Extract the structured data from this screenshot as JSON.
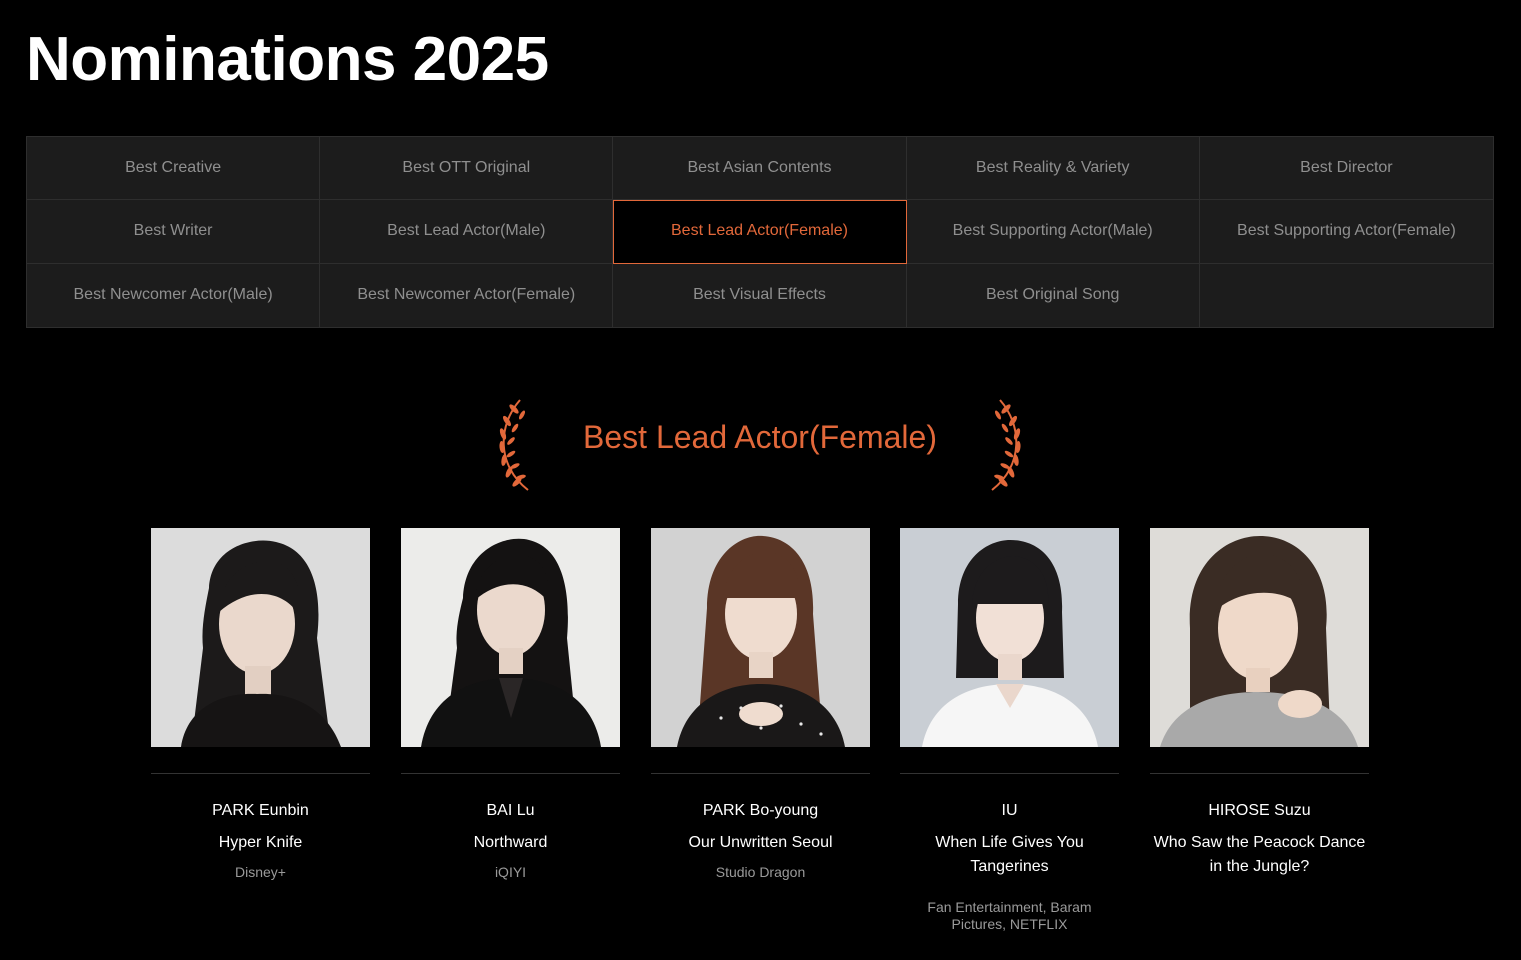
{
  "page": {
    "title": "Nominations 2025"
  },
  "categories": [
    {
      "label": "Best Creative",
      "active": false
    },
    {
      "label": "Best OTT Original",
      "active": false
    },
    {
      "label": "Best Asian Contents",
      "active": false
    },
    {
      "label": "Best Reality & Variety",
      "active": false
    },
    {
      "label": "Best Director",
      "active": false
    },
    {
      "label": "Best Writer",
      "active": false
    },
    {
      "label": "Best Lead Actor(Male)",
      "active": false
    },
    {
      "label": "Best Lead Actor(Female)",
      "active": true
    },
    {
      "label": "Best Supporting Actor(Male)",
      "active": false
    },
    {
      "label": "Best Supporting Actor(Female)",
      "active": false
    },
    {
      "label": "Best Newcomer Actor(Male)",
      "active": false
    },
    {
      "label": "Best Newcomer Actor(Female)",
      "active": false
    },
    {
      "label": "Best Visual Effects",
      "active": false
    },
    {
      "label": "Best Original Song",
      "active": false
    }
  ],
  "section": {
    "title": "Best Lead Actor(Female)",
    "icons": [
      "laurel-left-icon",
      "laurel-right-icon"
    ]
  },
  "nominees": [
    {
      "name": "PARK Eunbin",
      "work": "Hyper Knife",
      "studio": "Disney+"
    },
    {
      "name": "BAI Lu",
      "work": "Northward",
      "studio": "iQIYI"
    },
    {
      "name": "PARK Bo-young",
      "work": "Our Unwritten Seoul",
      "studio": "Studio Dragon"
    },
    {
      "name": "IU",
      "work": "When Life Gives You Tangerines",
      "studio": "Fan Entertainment, Baram Pictures, NETFLIX"
    },
    {
      "name": "HIROSE Suzu",
      "work": "Who Saw the Peacock Dance in the Jungle?",
      "studio": ""
    }
  ],
  "colors": {
    "background": "#000000",
    "accent": "#e2683a",
    "cell_background": "#1c1c1c",
    "muted_text": "#8f8f8f"
  }
}
